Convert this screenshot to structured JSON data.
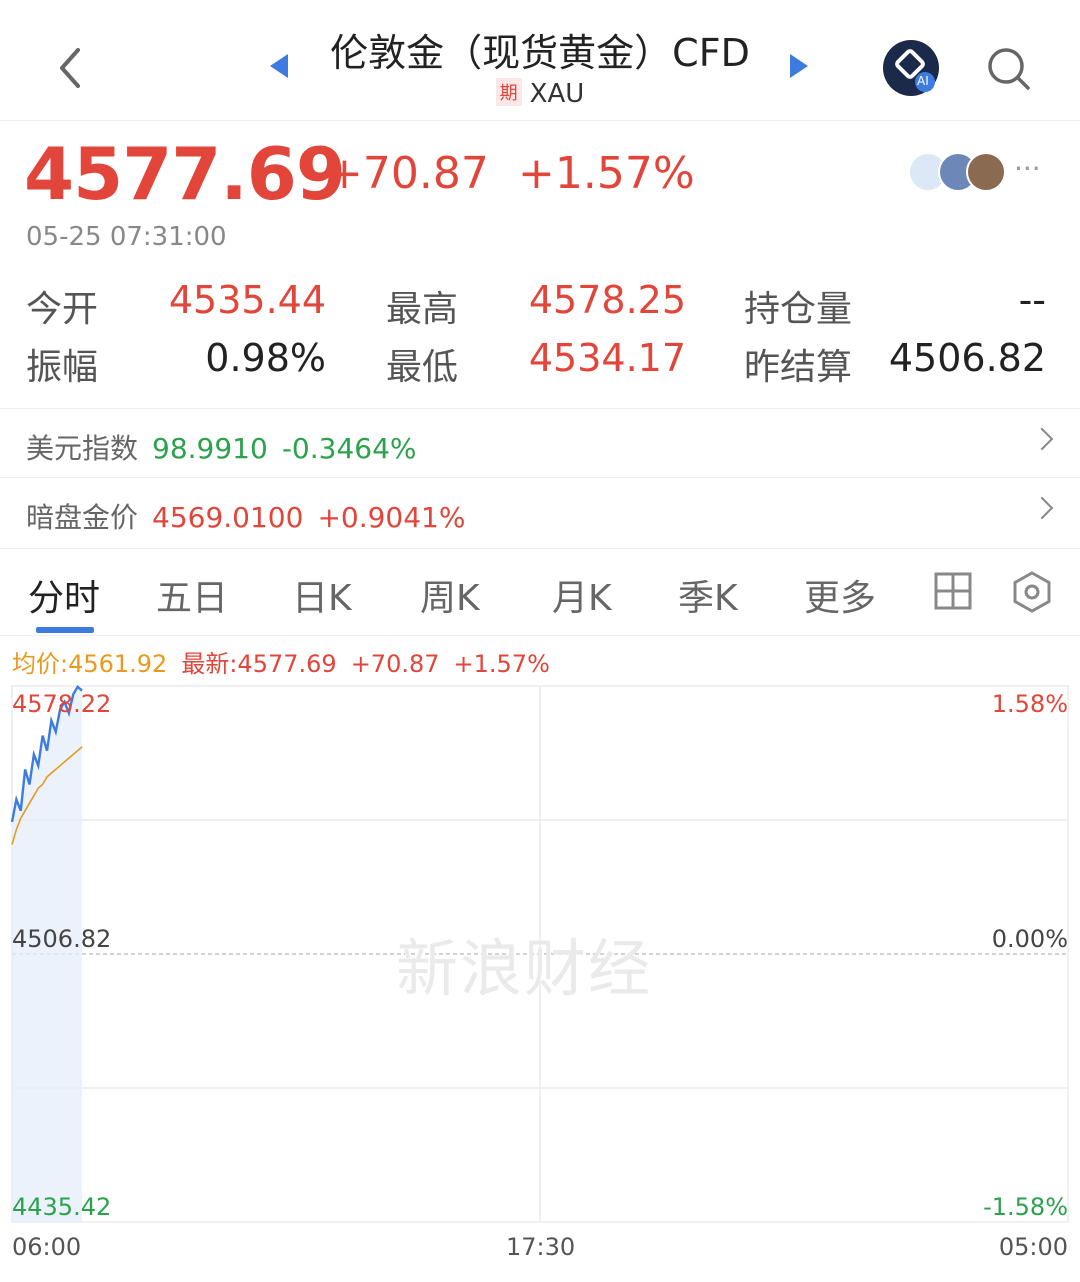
{
  "header": {
    "title": "伦敦金（现货黄金）CFD",
    "tag": "期",
    "symbol": "XAU",
    "ai_badge": "AI"
  },
  "quote": {
    "price": "4577.69",
    "change": "+70.87",
    "change_pct": "+1.57%",
    "time": "05-25 07:31:00",
    "more": "···"
  },
  "stats": {
    "open_label": "今开",
    "open": "4535.44",
    "high_label": "最高",
    "high": "4578.25",
    "oi_label": "持仓量",
    "oi": "--",
    "amp_label": "振幅",
    "amp": "0.98%",
    "low_label": "最低",
    "low": "4534.17",
    "prev_label": "昨结算",
    "prev": "4506.82"
  },
  "related": [
    {
      "label": "美元指数",
      "value": "98.9910",
      "change": "-0.3464%"
    },
    {
      "label": "暗盘金价",
      "value": "4569.0100",
      "change": "+0.9041%"
    }
  ],
  "tabs": [
    "分时",
    "五日",
    "日K",
    "周K",
    "月K",
    "季K",
    "更多"
  ],
  "legend": {
    "avg": "均价:4561.92",
    "latest": "最新:4577.69",
    "change": "+70.87",
    "pct": "+1.57%"
  },
  "watermark": "新浪财经",
  "colors": {
    "up": "#e2453a",
    "down": "#2ba24c",
    "line": "#3d7be0",
    "avg": "#e89a1e"
  },
  "chart_data": {
    "type": "line",
    "y_left_ticks": [
      "4578.22",
      "4506.82",
      "4435.42"
    ],
    "y_right_ticks": [
      "1.58%",
      "0.00%",
      "-1.58%"
    ],
    "x_ticks": [
      "06:00",
      "17:30",
      "05:00"
    ],
    "ylim": [
      4435.42,
      4578.22
    ],
    "baseline": 4506.82,
    "series": [
      {
        "values": [
          4542,
          4548,
          4545,
          4556,
          4552,
          4560,
          4557,
          4565,
          4561,
          4569,
          4566,
          4572,
          4574,
          4571,
          4576,
          4578,
          4577
        ]
      },
      {
        "values": [
          4536,
          4540,
          4543,
          4545,
          4547,
          4549,
          4551,
          4552,
          4554,
          4555,
          4556,
          4557,
          4558,
          4559,
          4560,
          4561,
          4562
        ]
      }
    ]
  }
}
